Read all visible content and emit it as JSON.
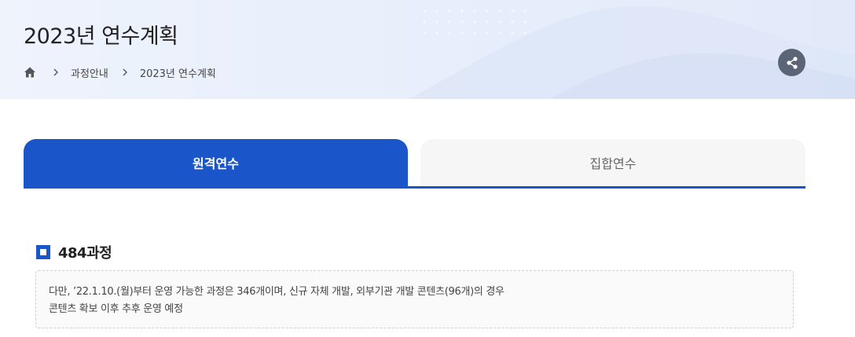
{
  "header": {
    "title": "2023년 연수계획",
    "breadcrumb": {
      "home_icon": "home-icon",
      "items": [
        "과정안내",
        "2023년 연수계획"
      ],
      "separator_icon": "chevron-right-icon"
    },
    "share_icon": "share-icon"
  },
  "tabs": [
    {
      "label": "원격연수",
      "active": true
    },
    {
      "label": "집합연수",
      "active": false
    }
  ],
  "section": {
    "title": "484과정",
    "note_lines": [
      "다만, ’22.1.10.(월)부터 운영 가능한 과정은 346개이며, 신규 자체 개발, 외부기관 개발 콘텐츠(96개)의 경우",
      "콘텐츠 확보 이후 추후 운영 예정"
    ]
  },
  "colors": {
    "accent": "#1a56c9",
    "hero_bg": "#eaf0fb",
    "share_bg": "#5c6578"
  }
}
